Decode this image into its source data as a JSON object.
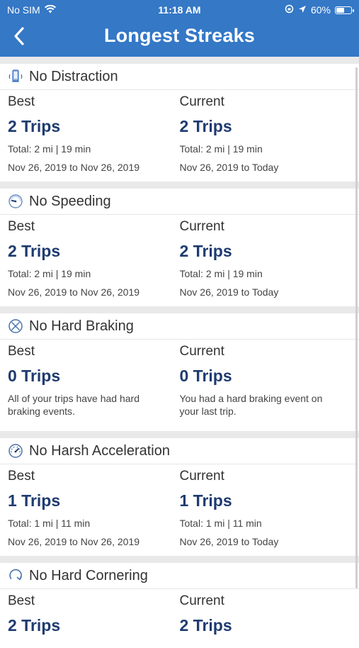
{
  "status": {
    "carrier": "No SIM",
    "time": "11:18 AM",
    "battery": "60%",
    "battery_level": 0.6
  },
  "header": {
    "title": "Longest Streaks"
  },
  "sections": [
    {
      "title": "No Distraction",
      "icon": "phone-icon",
      "best": {
        "label": "Best",
        "trips": "2 Trips",
        "total": "Total: 2 mi | 19 min",
        "dates": "Nov 26, 2019 to Nov 26, 2019"
      },
      "current": {
        "label": "Current",
        "trips": "2 Trips",
        "total": "Total: 2 mi | 19 min",
        "dates": "Nov 26, 2019 to Today"
      }
    },
    {
      "title": "No Speeding",
      "icon": "speedometer-icon",
      "best": {
        "label": "Best",
        "trips": "2 Trips",
        "total": "Total: 2 mi | 19 min",
        "dates": "Nov 26, 2019 to Nov 26, 2019"
      },
      "current": {
        "label": "Current",
        "trips": "2 Trips",
        "total": "Total: 2 mi | 19 min",
        "dates": "Nov 26, 2019 to Today"
      }
    },
    {
      "title": "No Hard Braking",
      "icon": "braking-icon",
      "best": {
        "label": "Best",
        "trips": "0 Trips",
        "message": "All of your trips have had hard braking events."
      },
      "current": {
        "label": "Current",
        "trips": "0 Trips",
        "message": "You had a hard braking event on your last trip."
      }
    },
    {
      "title": "No Harsh Acceleration",
      "icon": "acceleration-icon",
      "best": {
        "label": "Best",
        "trips": "1 Trips",
        "total": "Total: 1 mi | 11 min",
        "dates": "Nov 26, 2019 to Nov 26, 2019"
      },
      "current": {
        "label": "Current",
        "trips": "1 Trips",
        "total": "Total: 1 mi | 11 min",
        "dates": "Nov 26, 2019 to Today"
      }
    },
    {
      "title": "No Hard Cornering",
      "icon": "cornering-icon",
      "best": {
        "label": "Best",
        "trips": "2 Trips"
      },
      "current": {
        "label": "Current",
        "trips": "2 Trips"
      }
    }
  ]
}
